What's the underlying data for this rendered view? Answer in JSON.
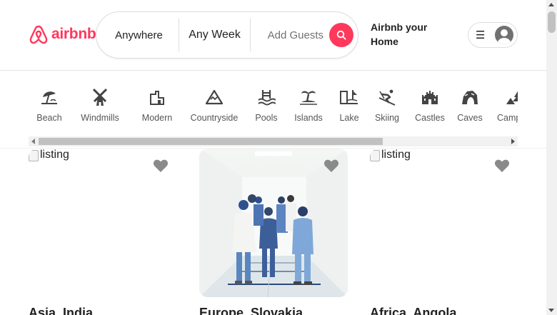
{
  "brand": {
    "logo_text": "airbnb",
    "icon": "airbnb-logo-icon",
    "color": "#ff385c"
  },
  "search": {
    "anywhere_label": "Anywhere",
    "week_label": "Any Week",
    "guests_label": "Add Guests",
    "button_icon": "search-icon",
    "button_color": "#ff385c"
  },
  "header": {
    "host_link": "Airbnb your Home",
    "menu_icon": "hamburger-icon",
    "avatar_icon": "user-avatar-icon"
  },
  "categories": [
    {
      "label": "Beach",
      "icon": "beach-umbrella-icon"
    },
    {
      "label": "Windmills",
      "icon": "windmill-icon"
    },
    {
      "label": "Modern",
      "icon": "modern-house-icon"
    },
    {
      "label": "Countryside",
      "icon": "mountain-icon"
    },
    {
      "label": "Pools",
      "icon": "pool-ladder-icon"
    },
    {
      "label": "Islands",
      "icon": "island-palm-icon"
    },
    {
      "label": "Lake",
      "icon": "lake-dock-icon"
    },
    {
      "label": "Skiing",
      "icon": "skier-icon"
    },
    {
      "label": "Castles",
      "icon": "castle-icon"
    },
    {
      "label": "Caves",
      "icon": "cave-icon"
    },
    {
      "label": "Camping",
      "icon": "tent-tree-icon"
    }
  ],
  "listings": [
    {
      "title": "Asia, India",
      "image_alt": "listing",
      "image_state": "broken",
      "favorite_icon": "heart-icon"
    },
    {
      "title": "Europe, Slovakia",
      "image_alt": "listing",
      "image_state": "loaded",
      "favorite_icon": "heart-icon"
    },
    {
      "title": "Africa, Angola",
      "image_alt": "listing",
      "image_state": "broken",
      "favorite_icon": "heart-icon"
    }
  ]
}
